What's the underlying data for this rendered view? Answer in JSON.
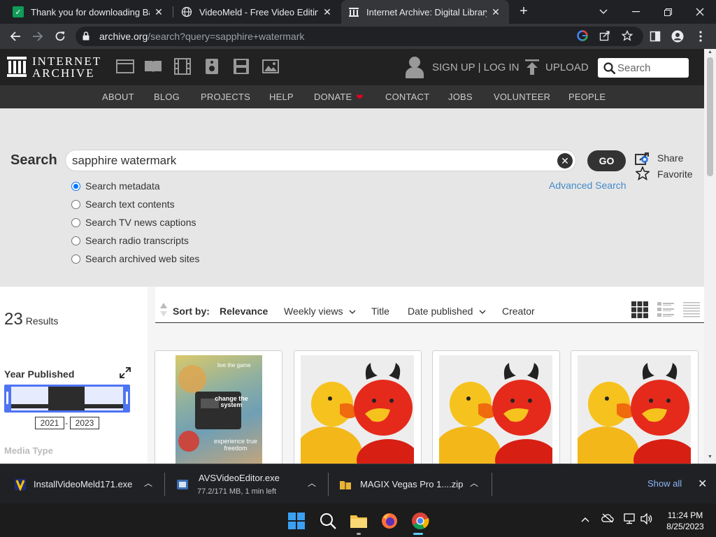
{
  "browser": {
    "tabs": [
      {
        "title": "Thank you for downloading Band",
        "favicon": "sheets-icon"
      },
      {
        "title": "VideoMeld - Free Video Editing S",
        "favicon": "globe-icon"
      },
      {
        "title": "Internet Archive: Digital Library o",
        "favicon": "archive-icon",
        "active": true
      }
    ],
    "url_domain": "archive.org",
    "url_path": "/search?query=sapphire+watermark"
  },
  "ia": {
    "logo_line1": "INTERNET",
    "logo_line2": "ARCHIVE",
    "signup": "SIGN UP | LOG IN",
    "upload": "UPLOAD",
    "search_placeholder": "Search",
    "nav": [
      "ABOUT",
      "BLOG",
      "PROJECTS",
      "HELP",
      "DONATE",
      "CONTACT",
      "JOBS",
      "VOLUNTEER",
      "PEOPLE"
    ]
  },
  "search": {
    "label": "Search",
    "query": "sapphire watermark",
    "go": "GO",
    "share": "Share",
    "favorite": "Favorite",
    "advanced": "Advanced Search",
    "options": [
      {
        "label": "Search metadata",
        "checked": true
      },
      {
        "label": "Search text contents",
        "checked": false
      },
      {
        "label": "Search TV news captions",
        "checked": false
      },
      {
        "label": "Search radio transcripts",
        "checked": false
      },
      {
        "label": "Search archived web sites",
        "checked": false
      }
    ]
  },
  "results": {
    "count": "23",
    "count_label": "Results",
    "year_heading": "Year Published",
    "year_from": "2021",
    "year_to": "2023",
    "media_heading": "Media Type",
    "sort_by": "Sort by:",
    "sort_options": [
      "Relevance",
      "Weekly views",
      "Title",
      "Date published",
      "Creator"
    ],
    "cover_text": [
      "live the game",
      "change the system",
      "experience true freedom"
    ]
  },
  "downloads": {
    "items": [
      {
        "name": "InstallVideoMeld171.exe",
        "sub": ""
      },
      {
        "name": "AVSVideoEditor.exe",
        "sub": "77.2/171 MB, 1 min left"
      },
      {
        "name": "MAGIX Vegas Pro 1....zip",
        "sub": ""
      }
    ],
    "show_all": "Show all"
  },
  "taskbar": {
    "time": "11:24 PM",
    "date": "8/25/2023"
  }
}
